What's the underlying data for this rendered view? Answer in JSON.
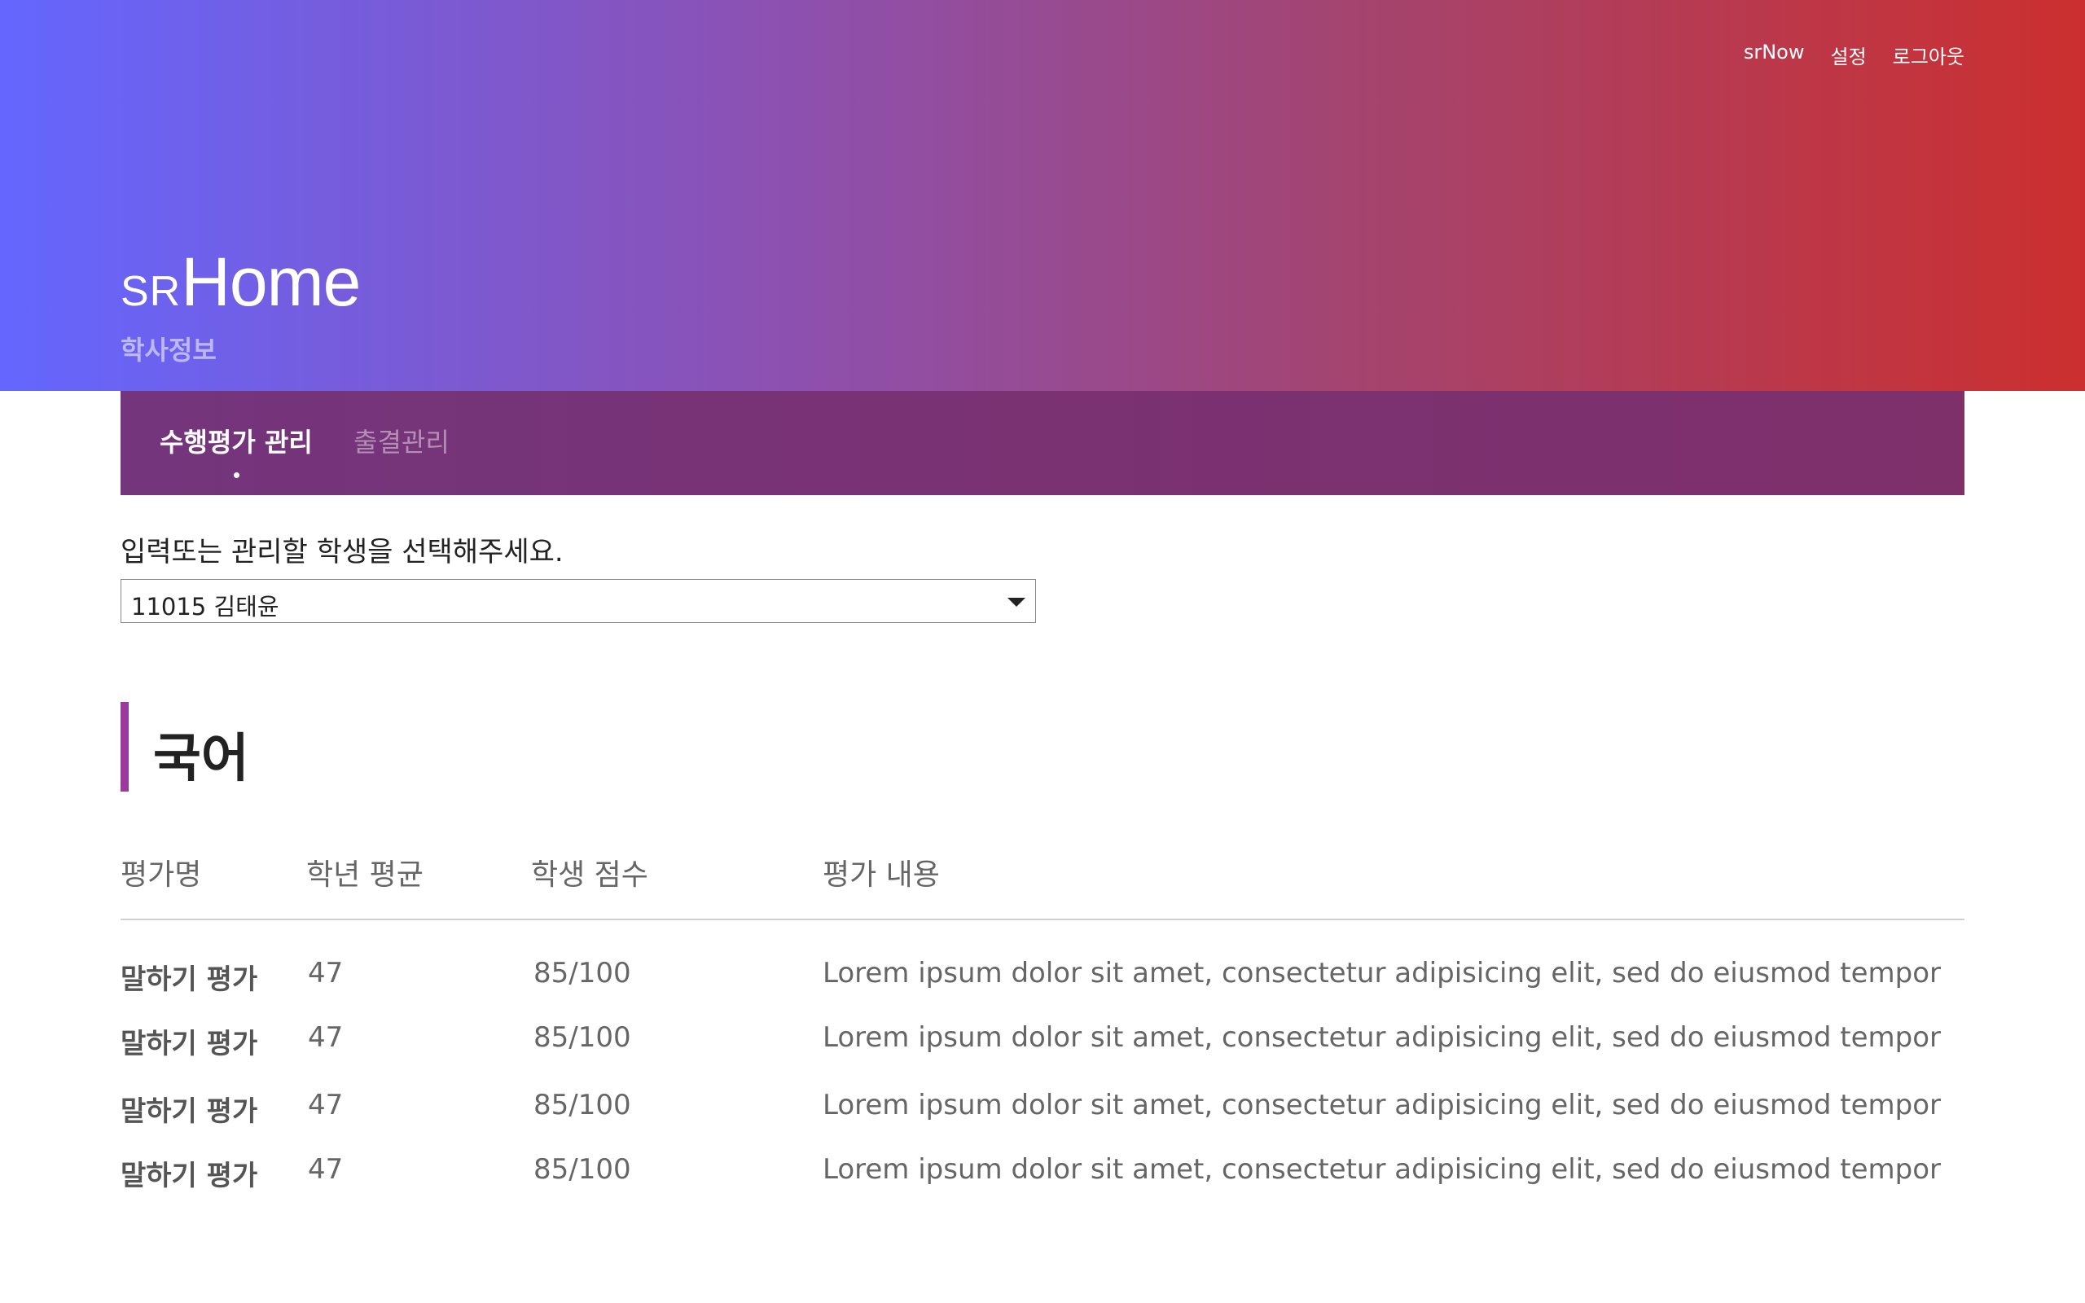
{
  "header": {
    "nav": [
      "srNow",
      "설정",
      "로그아웃"
    ],
    "brand_prefix": "SR",
    "brand_main": "Home",
    "subtitle": "학사정보"
  },
  "tabs": {
    "active": "수행평가 관리",
    "inactive": "출결관리"
  },
  "student_select": {
    "prompt": "입력또는 관리할 학생을 선택해주세요.",
    "value": "11015 김태윤"
  },
  "section": {
    "title": "국어",
    "columns": [
      "평가명",
      "학년 평균",
      "학생 점수",
      "평가 내용"
    ],
    "rows": [
      {
        "name": "말하기 평가",
        "avg": "47",
        "score": "85/100",
        "desc": "Lorem ipsum dolor sit amet, consectetur adipisicing elit, sed do eiusmod tempor"
      },
      {
        "name": "말하기 평가",
        "avg": "47",
        "score": "85/100",
        "desc": "Lorem ipsum dolor sit amet, consectetur adipisicing elit, sed do eiusmod tempor"
      },
      {
        "name": "말하기 평가",
        "avg": "47",
        "score": "85/100",
        "desc": "Lorem ipsum dolor sit amet, consectetur adipisicing elit, sed do eiusmod tempor"
      },
      {
        "name": "말하기 평가",
        "avg": "47",
        "score": "85/100",
        "desc": "Lorem ipsum dolor sit amet, consectetur adipisicing elit, sed do eiusmod tempor"
      }
    ]
  },
  "colors": {
    "gradient_start": "#6466ff",
    "gradient_end": "#cc2f2f",
    "tab_bar": "#7b3171",
    "section_accent": "#9a3a9d"
  }
}
